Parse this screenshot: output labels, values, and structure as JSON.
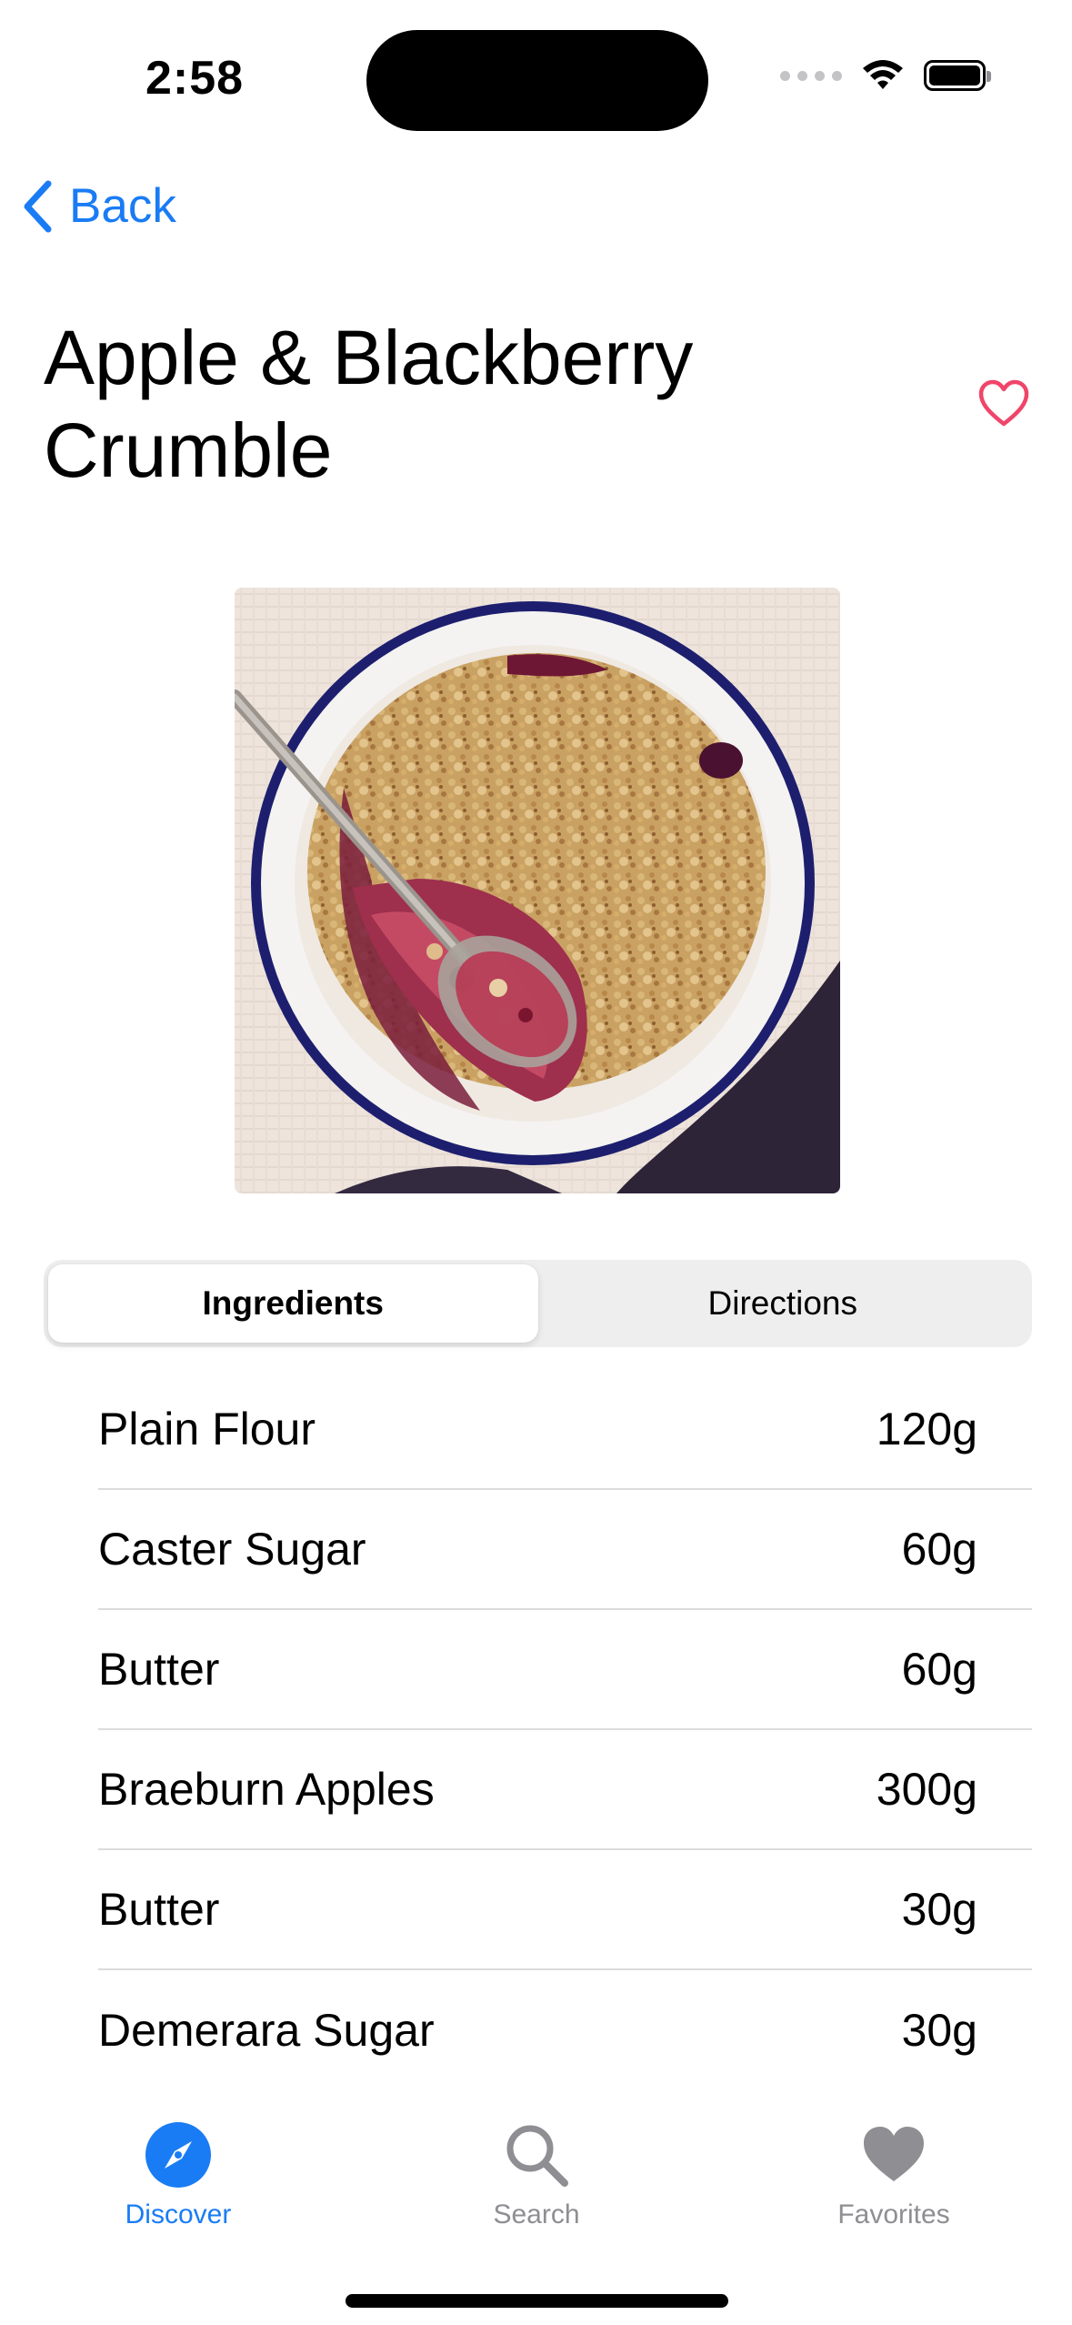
{
  "status_bar": {
    "time": "2:58"
  },
  "nav": {
    "back_label": "Back"
  },
  "recipe": {
    "title": "Apple & Blackberry Crumble",
    "favorited": false
  },
  "segments": [
    {
      "label": "Ingredients",
      "selected": true
    },
    {
      "label": "Directions",
      "selected": false
    }
  ],
  "ingredients": [
    {
      "name": "Plain Flour",
      "amount": "120g"
    },
    {
      "name": "Caster Sugar",
      "amount": "60g"
    },
    {
      "name": "Butter",
      "amount": "60g"
    },
    {
      "name": "Braeburn Apples",
      "amount": "300g"
    },
    {
      "name": "Butter",
      "amount": "30g"
    },
    {
      "name": "Demerara Sugar",
      "amount": "30g"
    }
  ],
  "tabs": [
    {
      "label": "Discover",
      "icon": "compass-icon",
      "selected": true
    },
    {
      "label": "Search",
      "icon": "magnifying-glass-icon",
      "selected": false
    },
    {
      "label": "Favorites",
      "icon": "heart-icon",
      "selected": false
    }
  ],
  "colors": {
    "accent": "#1a7cf5",
    "favorite": "#f0456a",
    "inactive": "#8e8e93",
    "separator": "#dcdcde",
    "segment_bg": "#eeeeef"
  }
}
